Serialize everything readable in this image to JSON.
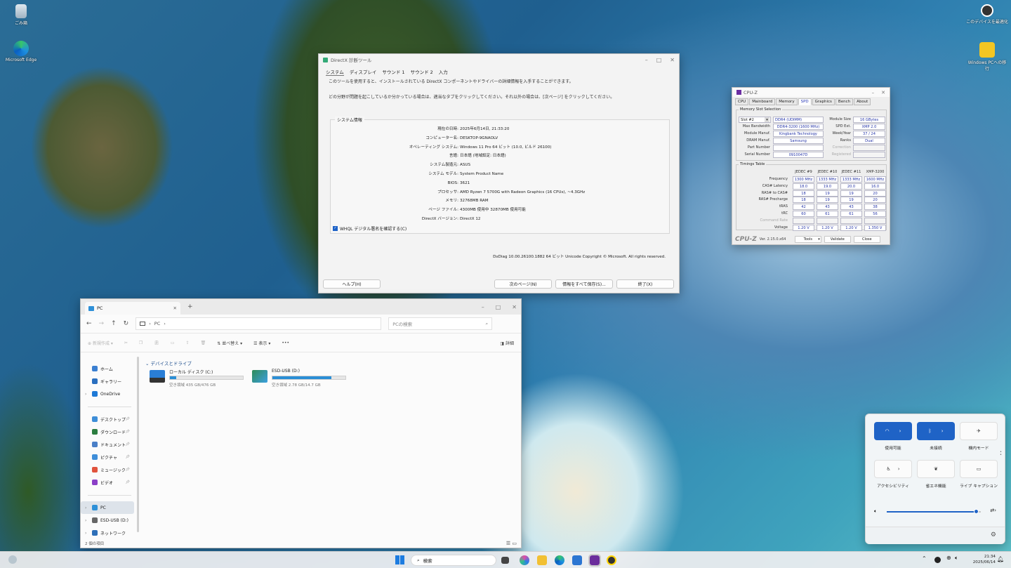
{
  "desktop": {
    "icons": [
      {
        "label": "ごみ箱",
        "icon": "recycle-bin-icon"
      },
      {
        "label": "Microsoft Edge",
        "icon": "edge-icon"
      },
      {
        "label": "このデバイスを最適化",
        "icon": "device-icon"
      },
      {
        "label": "Windows PCへの移行",
        "icon": "folder-icon"
      }
    ]
  },
  "dxdiag": {
    "title": "DirectX 診断ツール",
    "tabs": [
      "システム",
      "ディスプレイ",
      "サウンド 1",
      "サウンド 2",
      "入力"
    ],
    "intro": "このツールを使用すると、インストールされている DirectX コンポーネントやドライバーの詳細情報を入手することができます。",
    "hint": "どの分野が問題を起こしているか分かっている場合は、適当なタブをクリックしてください。それ以外の場合は、[次ページ] をクリックしてください。",
    "group_title": "システム情報",
    "rows": [
      {
        "k": "現在の日時:",
        "v": "2025年6月14日, 21:33:20"
      },
      {
        "k": "コンピューター名:",
        "v": "DESKTOP-9GNAOLV"
      },
      {
        "k": "オペレーティング システム:",
        "v": "Windows 11 Pro 64 ビット (10.0, ビルド 26100)"
      },
      {
        "k": "言語:",
        "v": "日本語 (地域設定: 日本語)"
      },
      {
        "k": "システム製造元:",
        "v": "ASUS"
      },
      {
        "k": "システム モデル:",
        "v": "System Product Name"
      },
      {
        "k": "BIOS:",
        "v": "3621"
      },
      {
        "k": "プロセッサ:",
        "v": "AMD Ryzen 7 5700G with Radeon Graphics        (16 CPUs), ~4.3GHz"
      },
      {
        "k": "メモリ:",
        "v": "32768MB RAM"
      },
      {
        "k": "ページ ファイル:",
        "v": "4300MB 使用中 32870MB 使用可能"
      },
      {
        "k": "DirectX バージョン:",
        "v": "DirectX 12"
      }
    ],
    "whql": "WHQL デジタル署名を確認する(C)",
    "footer": "DxDiag 10.00.26100.1882 64 ビット Unicode  Copyright © Microsoft. All rights reserved.",
    "btn_help": "ヘルプ(H)",
    "btn_next": "次のページ(N)",
    "btn_save": "情報をすべて保存(S)...",
    "btn_exit": "終了(X)"
  },
  "cpuz": {
    "title": "CPU-Z",
    "tabs": [
      "CPU",
      "Mainboard",
      "Memory",
      "SPD",
      "Graphics",
      "Bench",
      "About"
    ],
    "slot_group": "Memory Slot Selection",
    "slot": "Slot #2",
    "type": "DDR4 (UDIMM)",
    "max_bw_label": "Max Bandwidth",
    "max_bw": "DDR4-3200 (1600 MHz)",
    "manuf_label": "Module Manuf.",
    "manuf": "Kingbank Technology",
    "dram_label": "DRAM Manuf.",
    "dram": "Samsung",
    "part_label": "Part Number",
    "part": "",
    "serial_label": "Serial Number",
    "serial": "0910047D",
    "size_label": "Module Size",
    "size": "16 GBytes",
    "spd_label": "SPD Ext.",
    "spd": "XMP 2.0",
    "week_label": "Week/Year",
    "week": "37 / 24",
    "ranks_label": "Ranks",
    "ranks": "Dual",
    "corr_label": "Correction",
    "reg_label": "Registered",
    "timing_group": "Timings Table",
    "cols": [
      "JEDEC #9",
      "JEDEC #10",
      "JEDEC #11",
      "XMP-3200"
    ],
    "trows": [
      {
        "k": "Frequency",
        "v": [
          "1300 MHz",
          "1333 MHz",
          "1333 MHz",
          "1600 MHz"
        ]
      },
      {
        "k": "CAS# Latency",
        "v": [
          "18.0",
          "19.0",
          "20.0",
          "16.0"
        ]
      },
      {
        "k": "RAS# to CAS#",
        "v": [
          "18",
          "19",
          "19",
          "20"
        ]
      },
      {
        "k": "RAS# Precharge",
        "v": [
          "18",
          "19",
          "19",
          "20"
        ]
      },
      {
        "k": "tRAS",
        "v": [
          "42",
          "43",
          "43",
          "38"
        ]
      },
      {
        "k": "tRC",
        "v": [
          "60",
          "61",
          "61",
          "56"
        ]
      },
      {
        "k": "Command Rate",
        "v": [
          "",
          "",
          "",
          ""
        ]
      },
      {
        "k": "Voltage",
        "v": [
          "1.20 V",
          "1.20 V",
          "1.20 V",
          "1.350 V"
        ]
      }
    ],
    "brand": "CPU-Z",
    "version": "Ver. 2.15.0.x64",
    "tools": "Tools",
    "validate": "Validate",
    "close": "Close"
  },
  "explorer": {
    "tab": "PC",
    "address": "PC",
    "search_placeholder": "PCの検索",
    "cmd": {
      "new": "新規作成",
      "sort": "並べ替え",
      "view": "表示",
      "more": "•••",
      "details": "詳細"
    },
    "sidebar": [
      {
        "label": "ホーム",
        "icon": "home-icon"
      },
      {
        "label": "ギャラリー",
        "icon": "gallery-icon"
      },
      {
        "label": "OneDrive",
        "icon": "cloud-icon"
      },
      {
        "label": "デスクトップ",
        "icon": "desktop-icon"
      },
      {
        "label": "ダウンロード",
        "icon": "download-icon"
      },
      {
        "label": "ドキュメント",
        "icon": "document-icon"
      },
      {
        "label": "ピクチャ",
        "icon": "pictures-icon"
      },
      {
        "label": "ミュージック",
        "icon": "music-icon"
      },
      {
        "label": "ビデオ",
        "icon": "video-icon"
      },
      {
        "label": "PC",
        "icon": "pc-icon"
      },
      {
        "label": "ESD-USB (D:)",
        "icon": "usb-drive-icon"
      },
      {
        "label": "ネットワーク",
        "icon": "network-icon"
      }
    ],
    "section": "デバイスとドライブ",
    "drives": [
      {
        "name": "ローカル ディスク (C:)",
        "free": "空き領域 435 GB/476 GB",
        "used": 0.09
      },
      {
        "name": "ESD-USB (D:)",
        "free": "空き領域 2.78 GB/14.7 GB",
        "used": 0.81
      }
    ],
    "status": "2 個の項目"
  },
  "quick": {
    "wifi": "使用可能",
    "bluetooth": "未接続",
    "airplane": "機内モード",
    "access": "アクセシビリティ",
    "energy": "省エネ機能",
    "caption": "ライブ キャプション",
    "volume": 0.95
  },
  "taskbar": {
    "search": "検索",
    "time": "21:34",
    "date": "2025/06/14"
  }
}
